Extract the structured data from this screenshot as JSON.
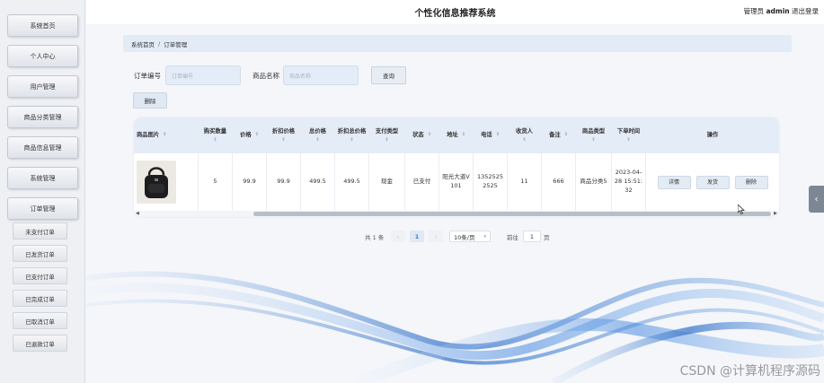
{
  "app_title": "个性化信息推荐系统",
  "user": {
    "role": "管理员",
    "name": "admin",
    "logout": "退出登录"
  },
  "sidebar": {
    "items": [
      {
        "label": "系统首页"
      },
      {
        "label": "个人中心"
      },
      {
        "label": "用户管理"
      },
      {
        "label": "商品分类管理"
      },
      {
        "label": "商品信息管理"
      },
      {
        "label": "系统管理"
      },
      {
        "label": "订单管理"
      }
    ],
    "subitems": [
      {
        "label": "未支付订单"
      },
      {
        "label": "已发货订单"
      },
      {
        "label": "已支付订单"
      },
      {
        "label": "已完成订单"
      },
      {
        "label": "已取消订单"
      },
      {
        "label": "已退款订单"
      }
    ]
  },
  "breadcrumb": {
    "home": "系统首页",
    "sep": "/",
    "current": "订单管理"
  },
  "search": {
    "order_label": "订单编号",
    "order_placeholder": "订单编号",
    "product_label": "商品名称",
    "product_placeholder": "商品名称",
    "query": "查询"
  },
  "toolbar": {
    "delete": "删除"
  },
  "table": {
    "columns": [
      {
        "label": "商品图片"
      },
      {
        "label": "购买数量"
      },
      {
        "label": "价格"
      },
      {
        "label": "折扣价格"
      },
      {
        "label": "总价格"
      },
      {
        "label": "折扣总价格"
      },
      {
        "label": "支付类型"
      },
      {
        "label": "状态"
      },
      {
        "label": "地址"
      },
      {
        "label": "电话"
      },
      {
        "label": "收货人"
      },
      {
        "label": "备注"
      },
      {
        "label": "商品类型"
      },
      {
        "label": "下单时间"
      },
      {
        "label": "操作"
      }
    ],
    "sort_glyph": "⇕",
    "row": {
      "quantity": "5",
      "price": "99.9",
      "discount_price": "99.9",
      "total": "499.5",
      "discount_total": "499.5",
      "pay_type": "现金",
      "status": "已支付",
      "address": "阳光大道V101",
      "phone": "13525252525",
      "receiver": "11",
      "remark": "666",
      "category": "商品分类5",
      "time": "2023-04-28 15:51:32",
      "actions": {
        "detail": "详情",
        "ship": "发货",
        "delete": "删除"
      }
    }
  },
  "pagination": {
    "total": "共 1 条",
    "prev": "‹",
    "page": "1",
    "next": "›",
    "page_size": "10条/页",
    "goto": "前往",
    "goto_value": "1",
    "page_unit": "页"
  },
  "side_tab_glyph": "‹",
  "watermark": "CSDN @计算机程序源码",
  "colors": {
    "header_bg": "#e4ecf7",
    "button_bg": "#e3ebf5",
    "wave": "#3b7dd8"
  }
}
